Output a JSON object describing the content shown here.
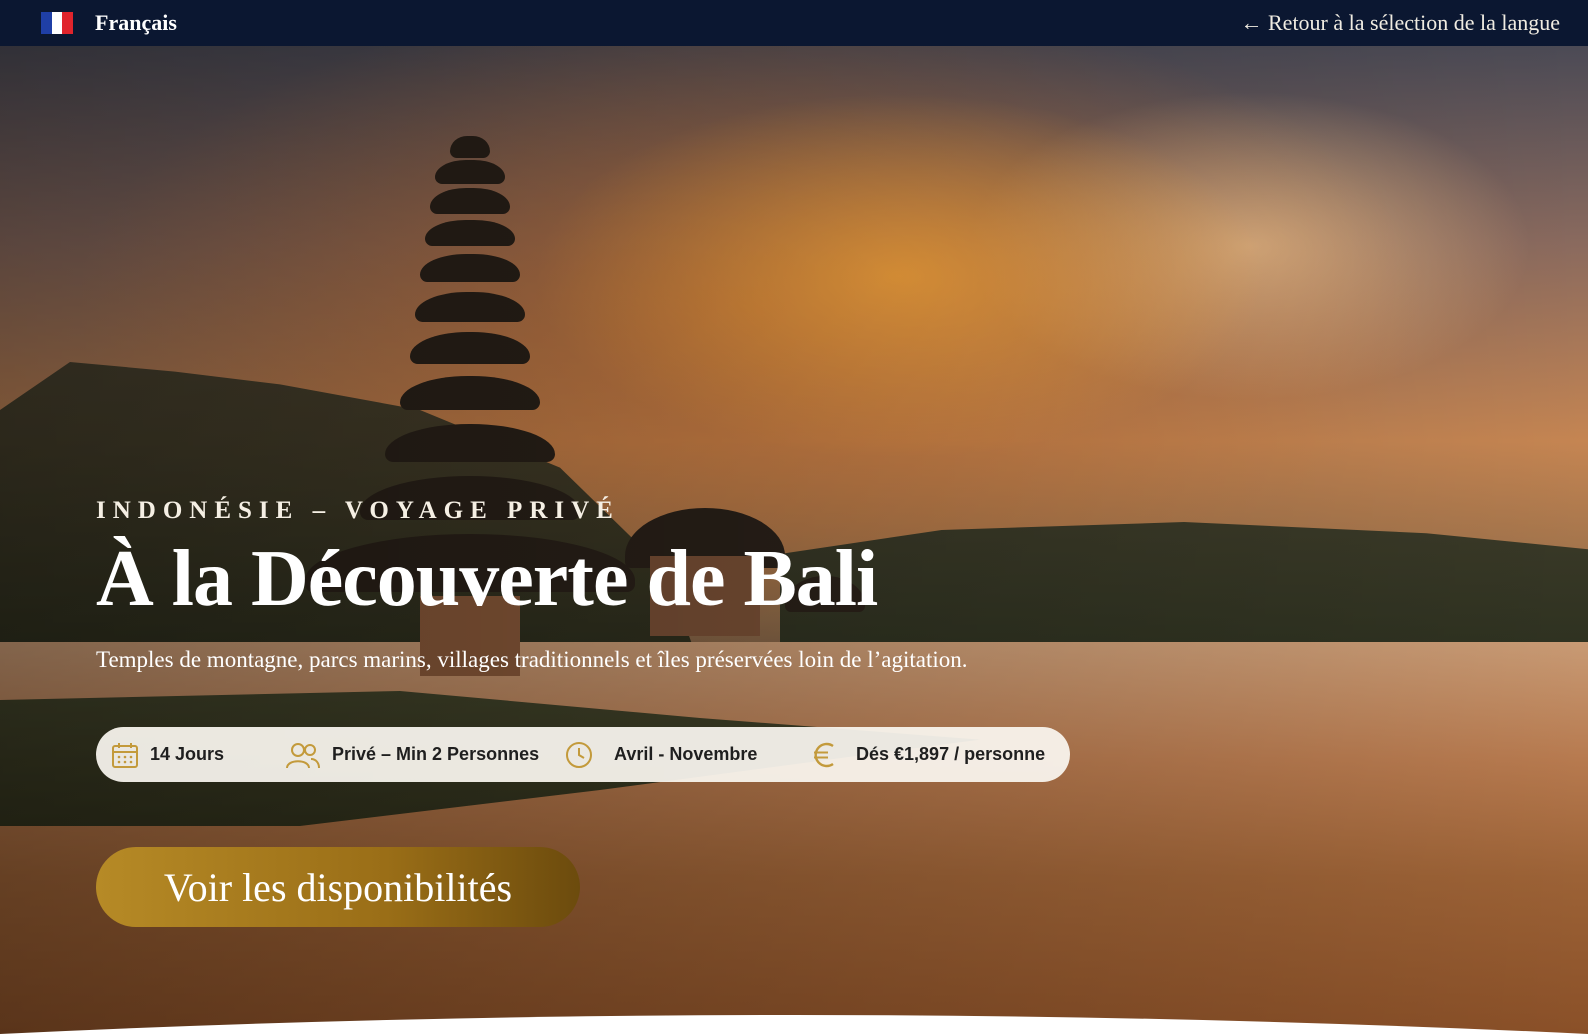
{
  "topbar": {
    "language_label": "Français",
    "back_link": "← Retour à la sélection de la langue"
  },
  "hero": {
    "eyebrow": "INDONÉSIE – VOYAGE PRIVÉ",
    "title": "À la Découverte de Bali",
    "subtitle": "Temples de montagne, parcs marins, villages traditionnels et îles préservées loin de l’agitation.",
    "details": [
      {
        "icon": "calendar-icon",
        "label": "14 Jours"
      },
      {
        "icon": "group-icon",
        "label": "Privé – Min 2 Personnes"
      },
      {
        "icon": "clock-icon",
        "label": "Avril - Novembre"
      },
      {
        "icon": "euro-icon",
        "label": "Dés €1,897 / personne"
      }
    ],
    "cta_label": "Voir les disponibilités"
  },
  "colors": {
    "topbar_bg": "#0b1731",
    "accent_gold": "#b68a26",
    "icon_gold": "#c39a3b"
  }
}
